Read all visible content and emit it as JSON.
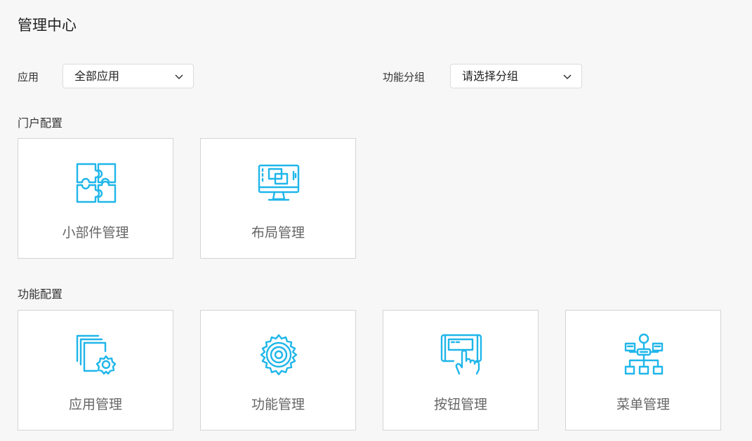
{
  "page": {
    "title": "管理中心"
  },
  "filters": {
    "app": {
      "label": "应用",
      "value": "全部应用"
    },
    "group": {
      "label": "功能分组",
      "value": "请选择分组"
    }
  },
  "sections": {
    "portal": {
      "title": "门户配置",
      "cards": [
        {
          "label": "小部件管理",
          "icon": "puzzle-icon"
        },
        {
          "label": "布局管理",
          "icon": "monitor-layout-icon"
        }
      ]
    },
    "function": {
      "title": "功能配置",
      "cards": [
        {
          "label": "应用管理",
          "icon": "app-settings-icon"
        },
        {
          "label": "功能管理",
          "icon": "gear-icon"
        },
        {
          "label": "按钮管理",
          "icon": "hand-click-icon"
        },
        {
          "label": "菜单管理",
          "icon": "sitemap-icon"
        }
      ]
    }
  },
  "colors": {
    "accent": "#1fb6ea",
    "card_border": "#d4d4d4",
    "background": "#f7f7f7"
  }
}
